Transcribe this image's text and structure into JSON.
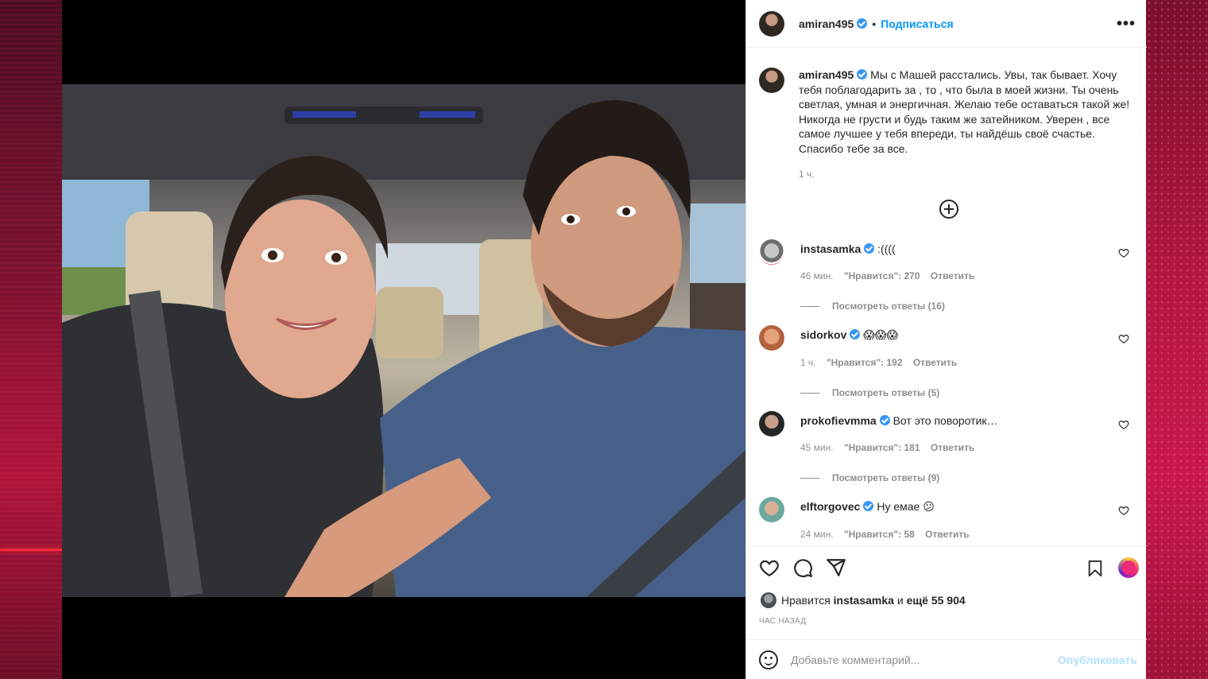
{
  "post": {
    "author": "amiran495",
    "follow_label": "Подписаться",
    "more_label": "•••",
    "caption": "Мы с Машей расстались. Увы, так бывает. Хочу тебя поблагодарить за , то , что была в моей жизни. Ты очень светлая, умная и энергичная. Желаю тебе оставаться такой же! Никогда не грусти и будь таким же затейником. Уверен , все самое лучшее у тебя впереди, ты найдёшь своё счастье. Спасибо тебе за все.",
    "caption_time": "1 ч."
  },
  "comments": [
    {
      "user": "instasamka",
      "text": ":((((",
      "time": "46 мин.",
      "likes": "\"Нравится\": 270",
      "reply": "Ответить",
      "view_replies": "Посмотреть ответы (16)"
    },
    {
      "user": "sidorkov",
      "text": "😱😱😱",
      "time": "1 ч.",
      "likes": "\"Нравится\": 192",
      "reply": "Ответить",
      "view_replies": "Посмотреть ответы (5)"
    },
    {
      "user": "prokofievmma",
      "text": "Вот это поворотик…",
      "time": "45 мин.",
      "likes": "\"Нравится\": 181",
      "reply": "Ответить",
      "view_replies": "Посмотреть ответы (9)"
    },
    {
      "user": "elftorgovec",
      "text": "Ну емае 😕",
      "time": "24 мин.",
      "likes": "\"Нравится\": 58",
      "reply": "Ответить"
    }
  ],
  "footer": {
    "likes_prefix": "Нравится",
    "likes_user": "instasamka",
    "likes_conj": "и",
    "likes_rest": "ещё 55 904",
    "time_ago": "ЧАС НАЗАД",
    "comment_placeholder": "Добавьте комментарий...",
    "publish_label": "Опубликовать"
  },
  "icons": {
    "like": "heart-icon",
    "comment": "comment-icon",
    "share": "share-icon",
    "save": "bookmark-icon",
    "emoji": "emoji-icon",
    "more": "more-options-icon",
    "add": "add-circle-icon"
  },
  "colors": {
    "link_blue": "#0095f6",
    "verified_blue": "#3897f0",
    "muted": "#8e8e8e",
    "publish_disabled": "#b2dffc"
  }
}
